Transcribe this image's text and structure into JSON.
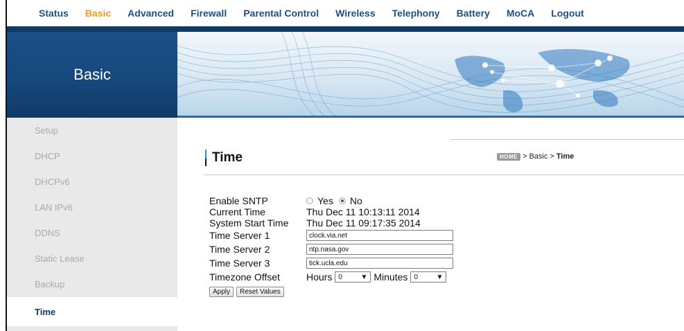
{
  "nav": {
    "items": [
      {
        "label": "Status",
        "active": false
      },
      {
        "label": "Basic",
        "active": true
      },
      {
        "label": "Advanced",
        "active": false
      },
      {
        "label": "Firewall",
        "active": false
      },
      {
        "label": "Parental Control",
        "active": false
      },
      {
        "label": "Wireless",
        "active": false
      },
      {
        "label": "Telephony",
        "active": false
      },
      {
        "label": "Battery",
        "active": false
      },
      {
        "label": "MoCA",
        "active": false
      },
      {
        "label": "Logout",
        "active": false
      }
    ],
    "active_color": "#f39a1a",
    "color": "#1b4f8a"
  },
  "banner": {
    "section_title": "Basic"
  },
  "sidebar": {
    "items": [
      {
        "label": "Setup",
        "active": false
      },
      {
        "label": "DHCP",
        "active": false
      },
      {
        "label": "DHCPv6",
        "active": false
      },
      {
        "label": "LAN IPv6",
        "active": false
      },
      {
        "label": "DDNS",
        "active": false
      },
      {
        "label": "Static Lease",
        "active": false
      },
      {
        "label": "Backup",
        "active": false
      },
      {
        "label": "Time",
        "active": true
      }
    ]
  },
  "page": {
    "title": "Time",
    "breadcrumb": {
      "home_badge": "HOME",
      "sep1": ">",
      "section": "Basic",
      "sep2": ">",
      "current": "Time"
    }
  },
  "form": {
    "enable_sntp": {
      "label": "Enable SNTP",
      "options": [
        "Yes",
        "No"
      ],
      "selected": "No"
    },
    "current_time": {
      "label": "Current Time",
      "value": "Thu Dec 11 10:13:11 2014"
    },
    "system_start_time": {
      "label": "System Start Time",
      "value": "Thu Dec 11 09:17:35 2014"
    },
    "time_server_1": {
      "label": "Time Server 1",
      "value": "clock.via.net"
    },
    "time_server_2": {
      "label": "Time Server 2",
      "value": "ntp.nasa.gov"
    },
    "time_server_3": {
      "label": "Time Server 3",
      "value": "tick.ucla.edu"
    },
    "timezone_offset": {
      "label": "Timezone Offset",
      "hours_label": "Hours",
      "hours_value": "0",
      "minutes_label": "Minutes",
      "minutes_value": "0"
    },
    "apply_label": "Apply",
    "reset_label": "Reset Values"
  }
}
